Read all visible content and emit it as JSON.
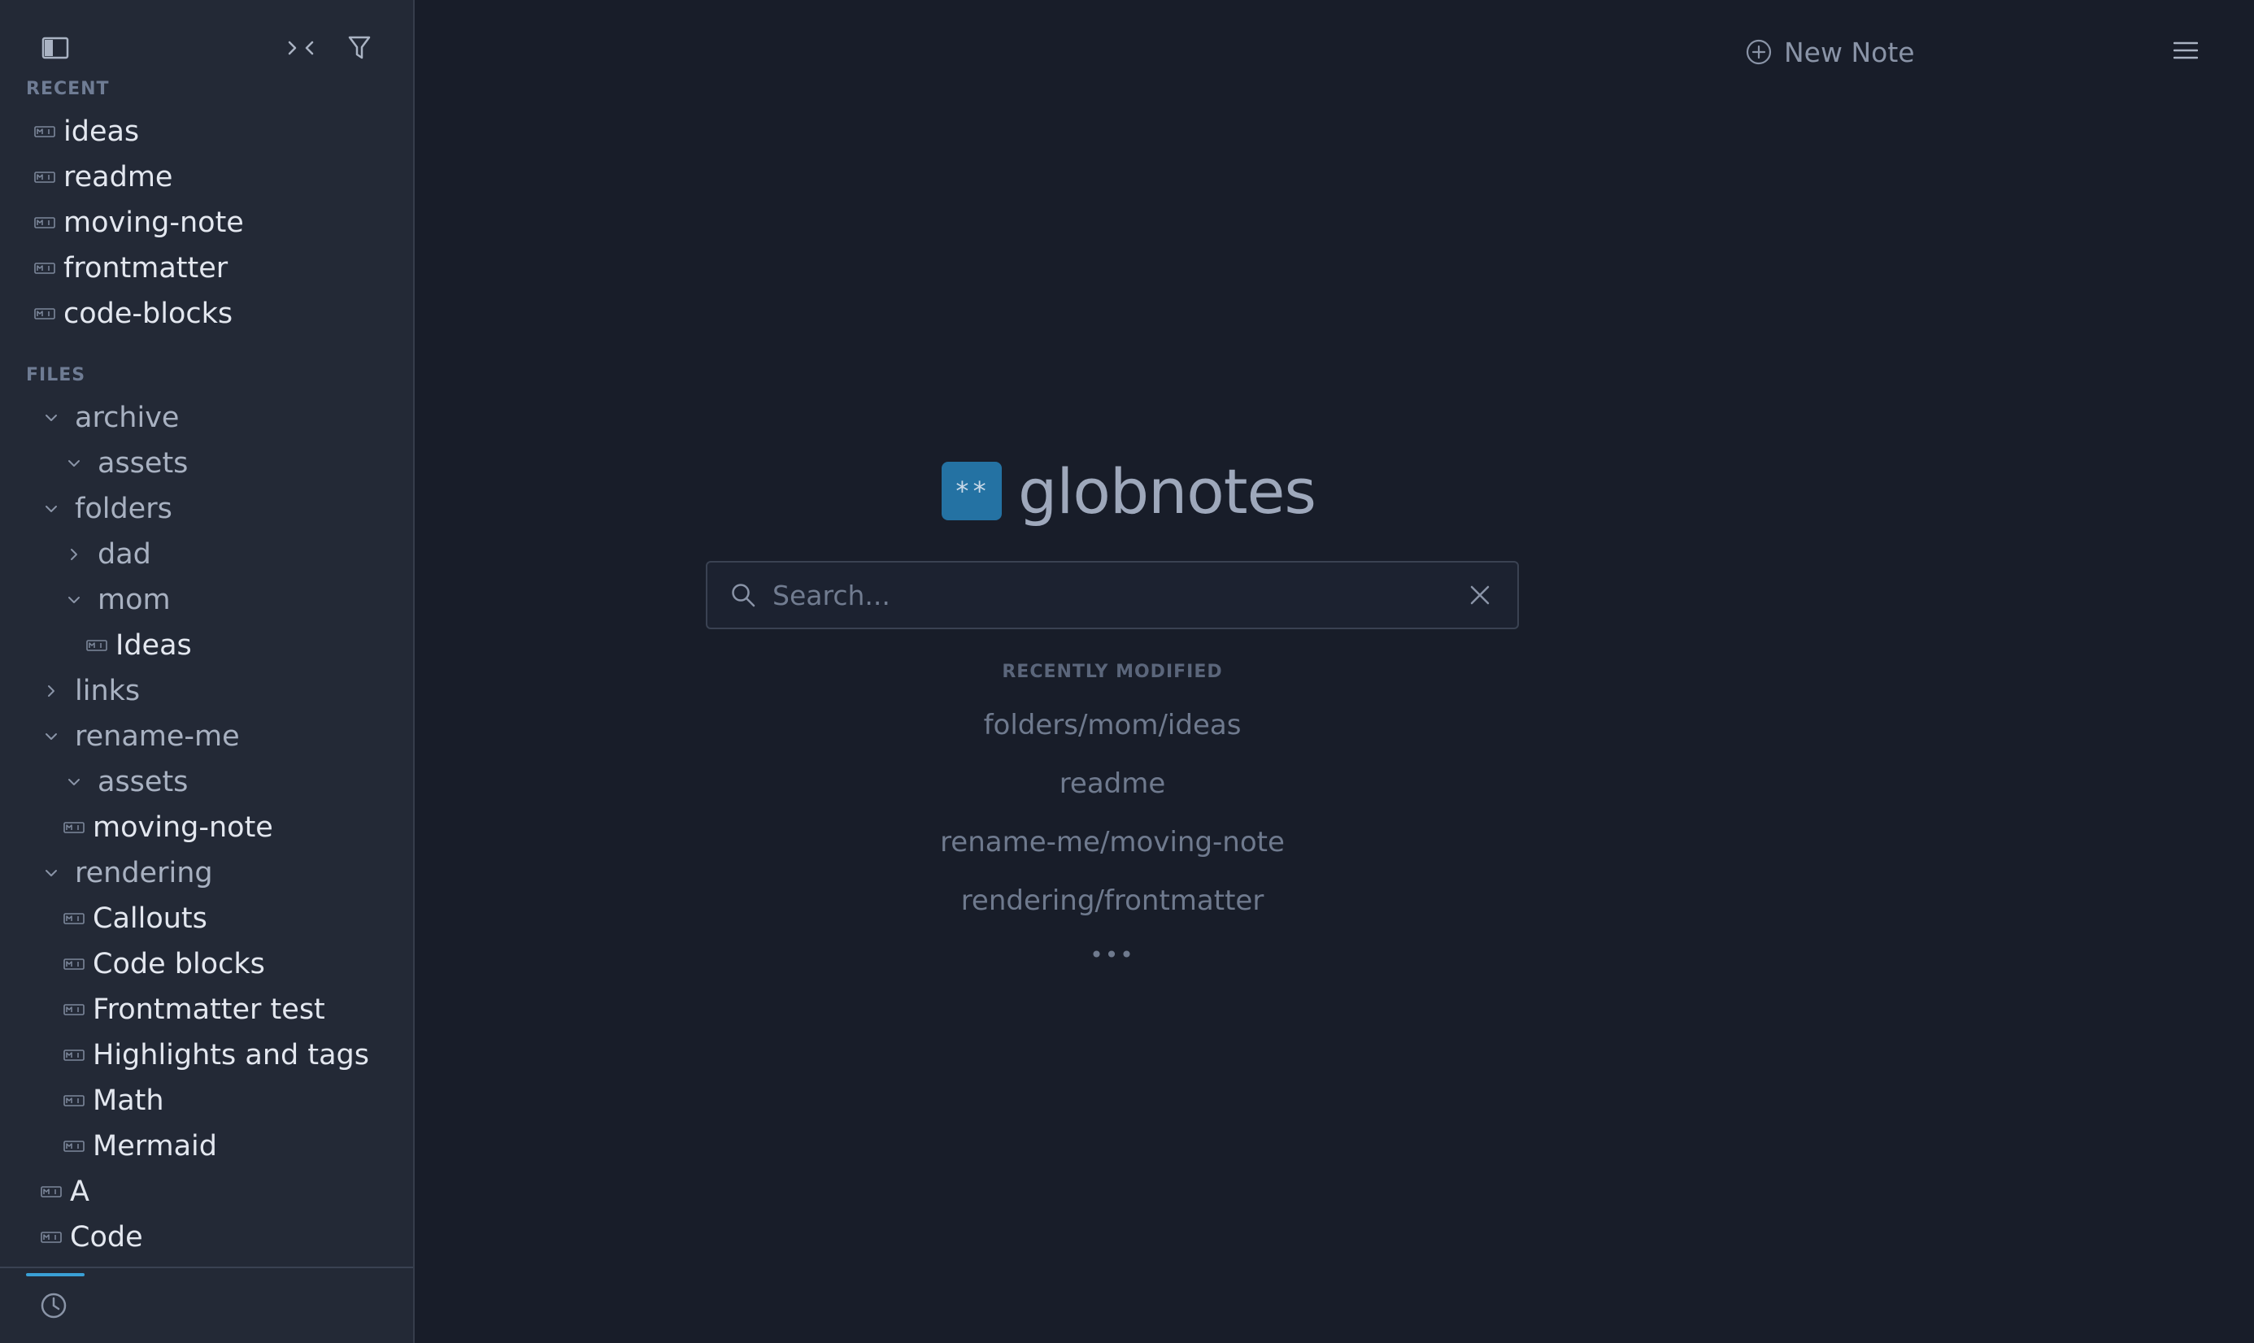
{
  "sidebar": {
    "toolbar": {
      "toggle_sidebar_icon": "sidebar-toggle-icon",
      "collapse_icon": "collapse-all-icon",
      "filter_icon": "filter-icon"
    },
    "recent_label": "RECENT",
    "recent": [
      {
        "label": "ideas"
      },
      {
        "label": "readme"
      },
      {
        "label": "moving-note"
      },
      {
        "label": "frontmatter"
      },
      {
        "label": "code-blocks"
      }
    ],
    "files_label": "FILES",
    "files": [
      {
        "label": "archive",
        "type": "folder",
        "depth": 0,
        "expanded": true
      },
      {
        "label": "assets",
        "type": "folder",
        "depth": 1,
        "expanded": true
      },
      {
        "label": "folders",
        "type": "folder",
        "depth": 0,
        "expanded": true
      },
      {
        "label": "dad",
        "type": "folder",
        "depth": 1,
        "expanded": false
      },
      {
        "label": "mom",
        "type": "folder",
        "depth": 1,
        "expanded": true
      },
      {
        "label": "Ideas",
        "type": "file",
        "depth": 2
      },
      {
        "label": "links",
        "type": "folder",
        "depth": 0,
        "expanded": false
      },
      {
        "label": "rename-me",
        "type": "folder",
        "depth": 0,
        "expanded": true
      },
      {
        "label": "assets",
        "type": "folder",
        "depth": 1,
        "expanded": true
      },
      {
        "label": "moving-note",
        "type": "file",
        "depth": 1
      },
      {
        "label": "rendering",
        "type": "folder",
        "depth": 0,
        "expanded": true
      },
      {
        "label": "Callouts",
        "type": "file",
        "depth": 1
      },
      {
        "label": "Code blocks",
        "type": "file",
        "depth": 1
      },
      {
        "label": "Frontmatter test",
        "type": "file",
        "depth": 1
      },
      {
        "label": "Highlights and tags",
        "type": "file",
        "depth": 1
      },
      {
        "label": "Math",
        "type": "file",
        "depth": 1
      },
      {
        "label": "Mermaid",
        "type": "file",
        "depth": 1
      },
      {
        "label": "A",
        "type": "file",
        "depth": 0
      },
      {
        "label": "Code",
        "type": "file",
        "depth": 0
      }
    ],
    "bottom": {
      "history_icon": "clock-icon"
    }
  },
  "main": {
    "new_note_label": "New Note",
    "menu_icon": "hamburger-menu-icon",
    "brand": {
      "logo_text": "**",
      "name": "globnotes"
    },
    "search": {
      "placeholder": "Search...",
      "value": ""
    },
    "recently_modified_label": "RECENTLY MODIFIED",
    "recently_modified": [
      "folders/mom/ideas",
      "readme",
      "rename-me/moving-note",
      "rendering/frontmatter"
    ],
    "more_label": "•••"
  },
  "colors": {
    "sidebar_bg": "#232936",
    "main_bg": "#181d29",
    "accent": "#3aa0d6",
    "logo_bg": "#2472a3"
  }
}
